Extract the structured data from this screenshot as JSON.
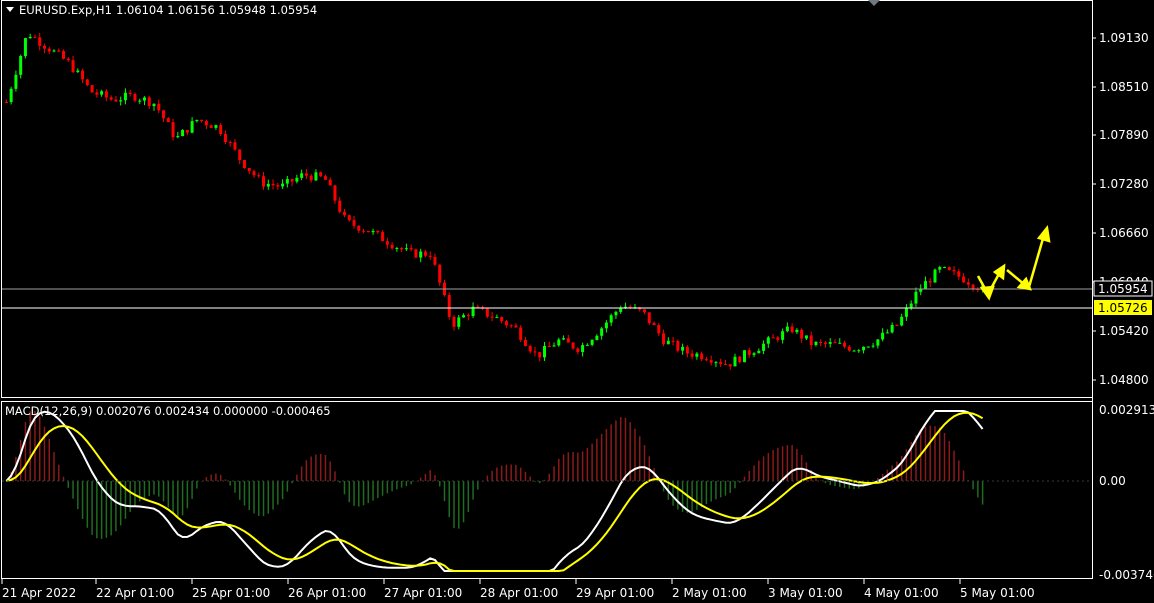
{
  "header": {
    "symbol": "EURUSD.Exp,H1",
    "ohlc": "1.06104 1.06156 1.05948 1.05954"
  },
  "price_axis": {
    "labels": [
      "1.09130",
      "1.08510",
      "1.07890",
      "1.07280",
      "1.06660",
      "1.06040",
      "1.05420",
      "1.04800"
    ]
  },
  "markers": {
    "bid": "1.05954",
    "level": "1.05726"
  },
  "macd": {
    "title": "MACD(12,26,9) 0.002076 0.002434 0.000000 -0.000465",
    "labels": [
      "0.002913",
      "0.00",
      "-0.003746"
    ]
  },
  "time_axis": {
    "labels": [
      "21 Apr 2022",
      "22 Apr 01:00",
      "25 Apr 01:00",
      "26 Apr 01:00",
      "27 Apr 01:00",
      "28 Apr 01:00",
      "29 Apr 01:00",
      "2 May 01:00",
      "3 May 01:00",
      "4 May 01:00",
      "5 May 01:00"
    ]
  },
  "colors": {
    "bull": "#00ff00",
    "bear": "#ff0000",
    "macd_line": "#ffffff",
    "signal_line": "#ffff00",
    "hist_pos": "#8b1a1a",
    "hist_neg": "#1f6b1f",
    "arrow": "#ffff00"
  },
  "chart_data": {
    "type": "candlestick",
    "symbol": "EURUSD.Exp",
    "timeframe": "H1",
    "price_close_approx": [
      1.0832,
      1.092,
      1.09,
      1.088,
      1.0845,
      1.0835,
      1.084,
      1.083,
      1.0785,
      1.081,
      1.08,
      1.076,
      1.073,
      1.0725,
      1.074,
      1.0735,
      1.068,
      1.067,
      1.0655,
      1.064,
      1.064,
      1.055,
      1.057,
      1.056,
      1.0545,
      1.051,
      1.053,
      1.052,
      1.0545,
      1.0575,
      1.0565,
      1.053,
      1.0515,
      1.051,
      1.05,
      1.0515,
      1.053,
      1.0545,
      1.0525,
      1.0525,
      1.052,
      1.053,
      1.055,
      1.0595,
      1.062,
      1.061,
      1.0595
    ],
    "macd_range": [
      -0.003746,
      0.002913
    ]
  }
}
